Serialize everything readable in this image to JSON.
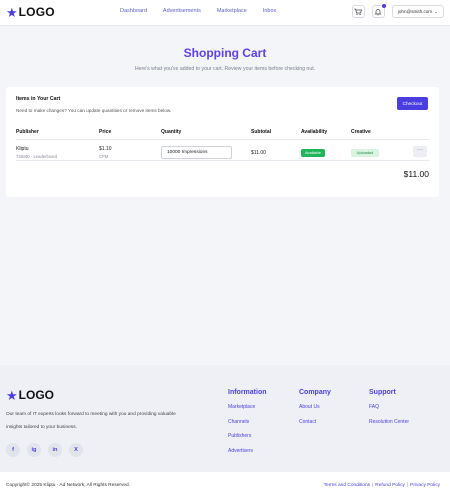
{
  "brand": {
    "name": "LOGO"
  },
  "nav": {
    "links": [
      "Dashboard",
      "Advertisements",
      "Marketplace",
      "Inbox"
    ],
    "user_email": "john@smith.com"
  },
  "page": {
    "title": "Shopping Cart",
    "subtitle": "Here's what you've added to your cart. Review your items before checking out."
  },
  "cart": {
    "heading": "Items in Your Cart",
    "description": "Need to make changes? You can update quantities or remove items below.",
    "checkout_label": "Checkout",
    "columns": [
      "Publisher",
      "Price",
      "Quantity",
      "Subtotal",
      "Availability",
      "Creative"
    ],
    "items": [
      {
        "publisher": "Kliptu",
        "format": "728x90 - Leaderboard",
        "price": "$1.10",
        "price_unit": "CPM",
        "quantity": "10000 Impressions",
        "subtotal": "$11.00",
        "availability": "Available",
        "creative": "Uploaded",
        "more": "···"
      }
    ],
    "total": "$11.00"
  },
  "footer": {
    "description": "Our team of IT experts looks forward to meeting with you and providing valuable insights tailored to your business.",
    "socials": [
      "f",
      "ig",
      "in",
      "X"
    ],
    "columns": [
      {
        "title": "Information",
        "links": [
          "Marketplace",
          "Channels",
          "Publishers",
          "Advertisers"
        ]
      },
      {
        "title": "Company",
        "links": [
          "About Us",
          "Contact"
        ]
      },
      {
        "title": "Support",
        "links": [
          "FAQ",
          "Resolution Center"
        ]
      }
    ],
    "copyright": "Copyright© 2025 Kliptu - Ad Network, All Rights Reserved.",
    "legal": [
      "Terms and Conditions",
      "Refund Policy",
      "Privacy Policy"
    ]
  },
  "colors": {
    "accent": "#4b3ee0",
    "title": "#6040e8",
    "available": "#21b45a",
    "uploaded_bg": "#d9f5e1"
  }
}
